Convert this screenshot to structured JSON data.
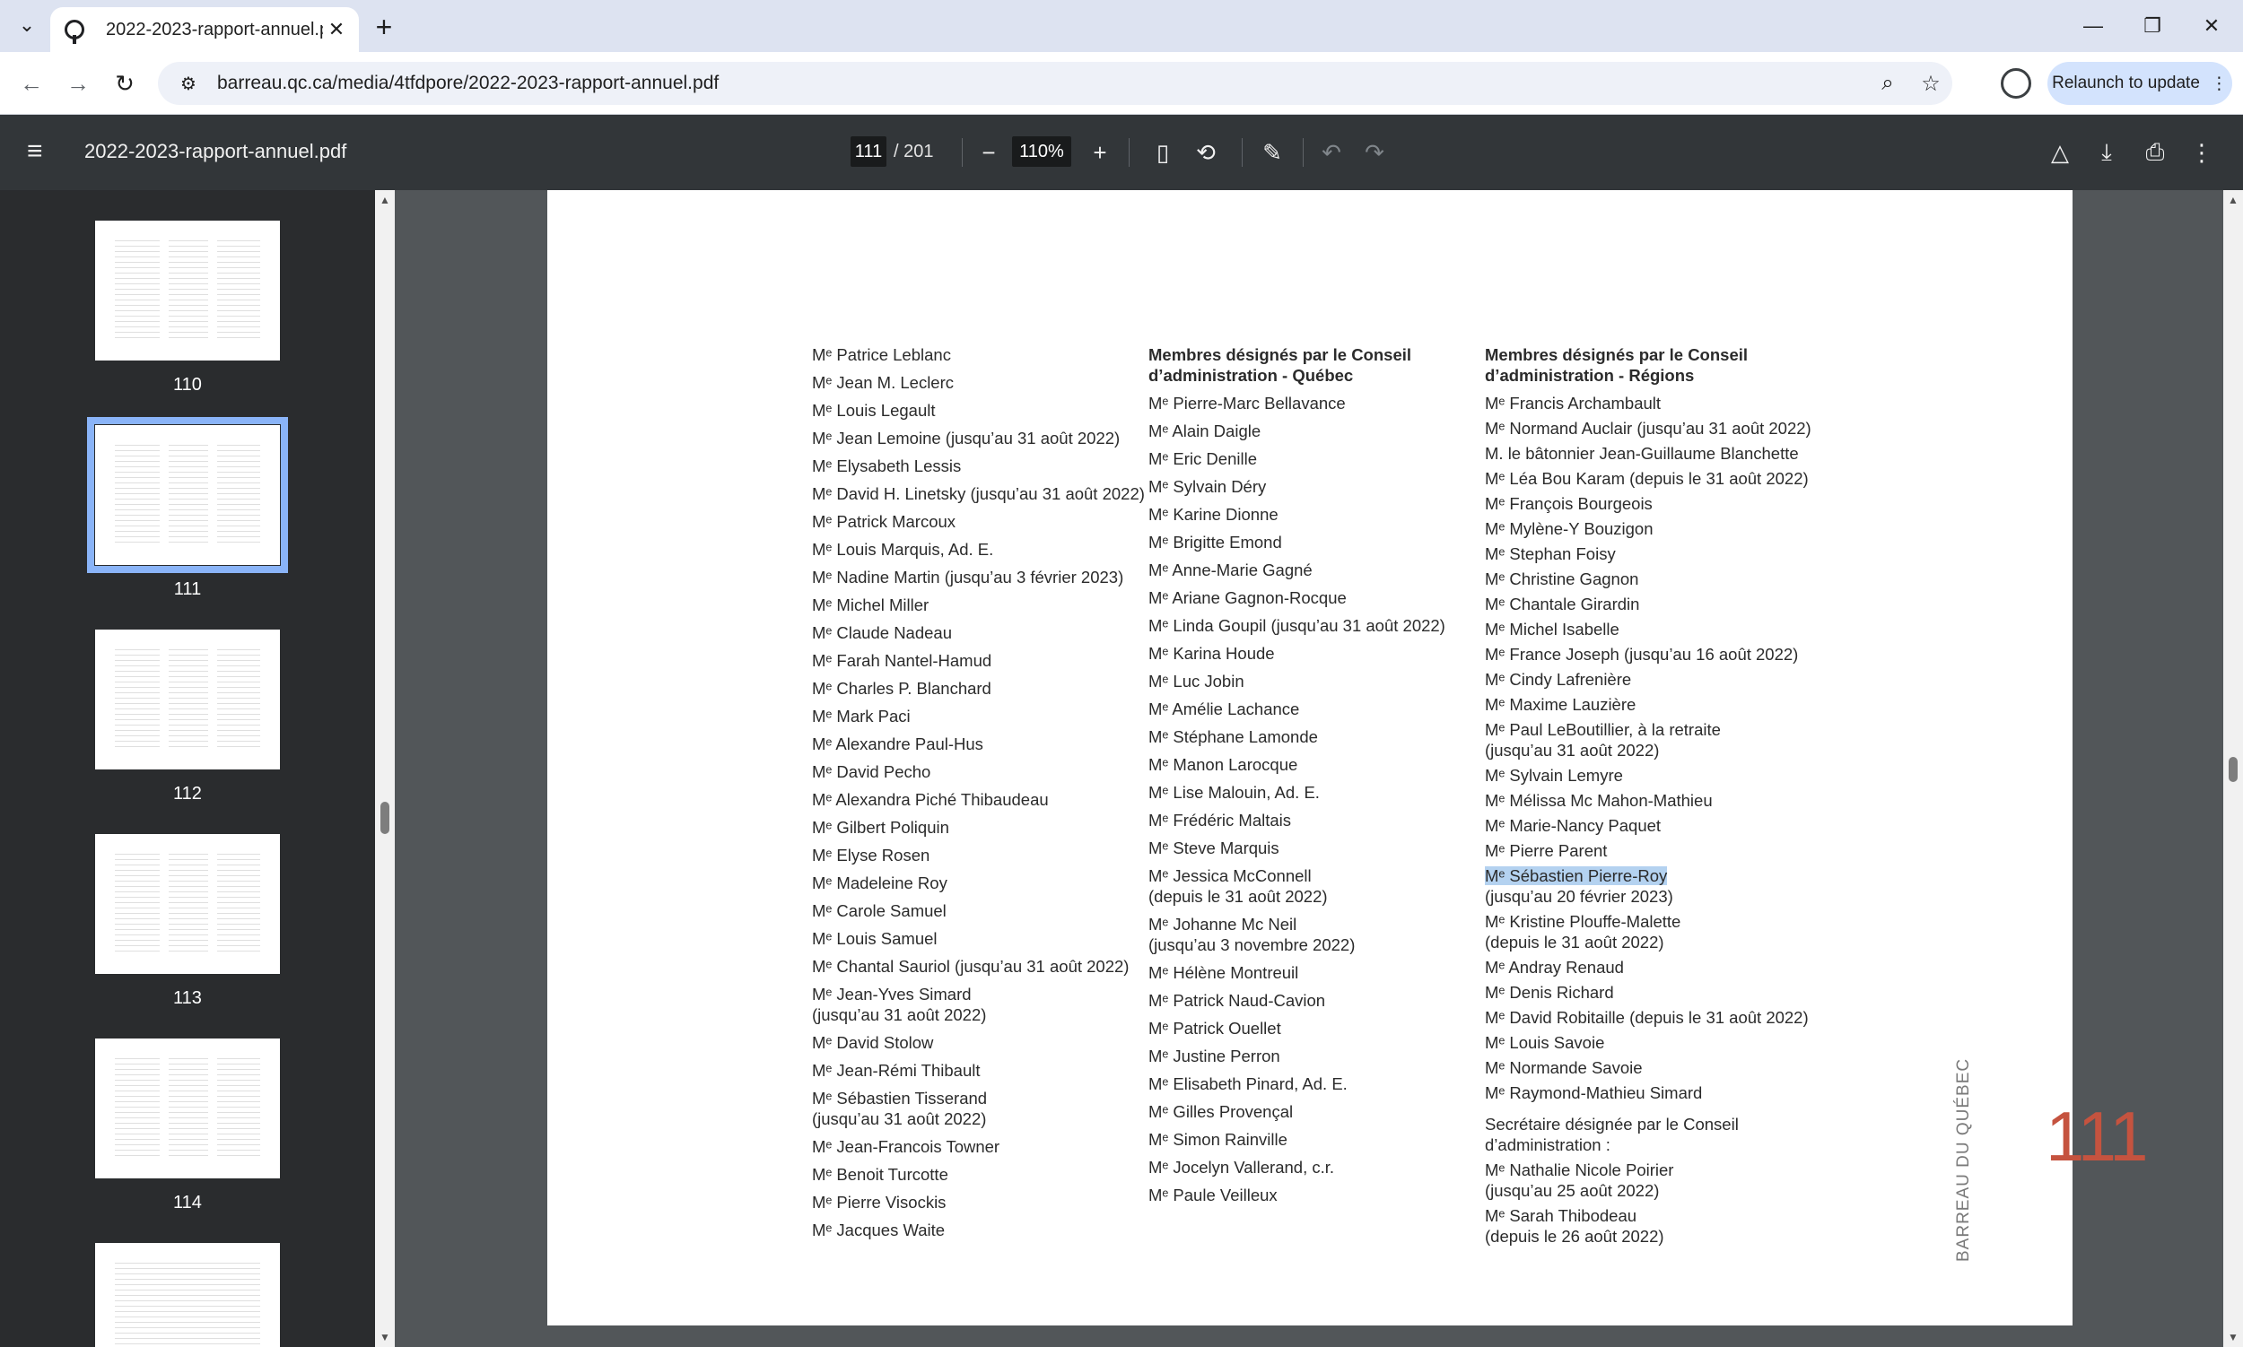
{
  "browser": {
    "tab_title": "2022-2023-rapport-annuel.pdf",
    "url": "barreau.qc.ca/media/4tfdpore/2022-2023-rapport-annuel.pdf",
    "relaunch_label": "Relaunch to update"
  },
  "pdf_toolbar": {
    "title": "2022-2023-rapport-annuel.pdf",
    "current_page": "111",
    "total_pages": "/ 201",
    "zoom": "110%"
  },
  "thumbnails": [
    {
      "label": "110"
    },
    {
      "label": "111"
    },
    {
      "label": "112"
    },
    {
      "label": "113"
    },
    {
      "label": "114"
    }
  ],
  "page": {
    "col1": [
      "Mᵉ Patrice Leblanc",
      "Mᵉ Jean M. Leclerc",
      "Mᵉ Louis Legault",
      "Mᵉ Jean Lemoine (jusqu’au 31 août 2022)",
      "Mᵉ Elysabeth Lessis",
      "Mᵉ David H. Linetsky (jusqu’au 31 août 2022)",
      "Mᵉ Patrick Marcoux",
      "Mᵉ Louis Marquis, Ad. E.",
      "Mᵉ Nadine Martin (jusqu’au 3 février 2023)",
      "Mᵉ Michel Miller",
      "Mᵉ Claude Nadeau",
      "Mᵉ Farah Nantel-Hamud",
      "Mᵉ Charles P. Blanchard",
      "Mᵉ Mark Paci",
      "Mᵉ Alexandre Paul-Hus",
      "Mᵉ David Pecho",
      "Mᵉ Alexandra Piché Thibaudeau",
      "Mᵉ Gilbert Poliquin",
      "Mᵉ Elyse Rosen",
      "Mᵉ Madeleine Roy",
      "Mᵉ Carole Samuel",
      "Mᵉ Louis Samuel",
      "Mᵉ Chantal Sauriol (jusqu’au 31 août 2022)",
      "Mᵉ Jean-Yves Simard\n(jusqu’au 31 août 2022)",
      "Mᵉ David Stolow",
      "Mᵉ Jean-Rémi Thibault",
      "Mᵉ Sébastien Tisserand\n(jusqu’au 31 août 2022)",
      "Mᵉ Jean-Francois Towner",
      "Mᵉ Benoit Turcotte",
      "Mᵉ Pierre Visockis",
      "Mᵉ Jacques Waite"
    ],
    "col2_heading": "Membres désignés par le Conseil\nd’administration - Québec",
    "col2": [
      "Mᵉ Pierre-Marc Bellavance",
      "Mᵉ Alain Daigle",
      "Mᵉ Eric Denille",
      "Mᵉ Sylvain Déry",
      "Mᵉ Karine Dionne",
      "Mᵉ Brigitte Emond",
      "Mᵉ Anne-Marie Gagné",
      "Mᵉ Ariane Gagnon-Rocque",
      "Mᵉ Linda Goupil (jusqu’au 31 août 2022)",
      "Mᵉ Karina Houde",
      "Mᵉ Luc Jobin",
      "Mᵉ Amélie Lachance",
      "Mᵉ Stéphane Lamonde",
      "Mᵉ Manon Larocque",
      "Mᵉ Lise Malouin, Ad. E.",
      "Mᵉ Frédéric Maltais",
      "Mᵉ Steve Marquis",
      "Mᵉ Jessica McConnell\n(depuis le 31 août 2022)",
      "Mᵉ Johanne Mc Neil\n(jusqu’au 3 novembre 2022)",
      "Mᵉ Hélène Montreuil",
      "Mᵉ Patrick Naud-Cavion",
      "Mᵉ Patrick Ouellet",
      "Mᵉ Justine Perron",
      "Mᵉ Elisabeth Pinard, Ad. E.",
      "Mᵉ Gilles Provençal",
      "Mᵉ Simon Rainville",
      "Mᵉ Jocelyn Vallerand, c.r.",
      "Mᵉ Paule Veilleux"
    ],
    "col3_heading": "Membres désignés par le Conseil\nd’administration - Régions",
    "col3_before": [
      "Mᵉ Francis Archambault",
      "Mᵉ Normand Auclair (jusqu’au 31 août 2022)",
      "M. le bâtonnier Jean-Guillaume Blanchette",
      "Mᵉ Léa Bou Karam (depuis le 31 août 2022)",
      "Mᵉ François Bourgeois",
      "Mᵉ Mylène-Y Bouzigon",
      "Mᵉ Stephan Foisy",
      "Mᵉ Christine Gagnon",
      "Mᵉ Chantale Girardin",
      "Mᵉ Michel Isabelle",
      "Mᵉ France Joseph (jusqu’au 16 août 2022)",
      "Mᵉ Cindy Lafrenière",
      "Mᵉ Maxime Lauzière",
      "Mᵉ Paul LeBoutillier, à la retraite\n(jusqu’au 31 août 2022)",
      "Mᵉ Sylvain Lemyre",
      "Mᵉ Mélissa Mc Mahon-Mathieu",
      "Mᵉ Marie-Nancy Paquet",
      "Mᵉ Pierre Parent"
    ],
    "col3_selected_name": "Mᵉ Sébastien Pierre-Roy",
    "col3_selected_note": "(jusqu’au 20 février 2023)",
    "col3_after": [
      "Mᵉ Kristine Plouffe-Malette\n(depuis le 31 août 2022)",
      "Mᵉ Andray Renaud",
      "Mᵉ Denis Richard",
      "Mᵉ David Robitaille (depuis le 31 août 2022)",
      "Mᵉ Louis Savoie",
      "Mᵉ Normande Savoie",
      "Mᵉ Raymond-Mathieu Simard"
    ],
    "secretary_heading": "Secrétaire désignée par le Conseil\nd’administration :",
    "secretaries": [
      "Mᵉ Nathalie Nicole Poirier\n(jusqu’au 25 août 2022)",
      "Mᵉ Sarah Thibodeau\n(depuis le 26 août 2022)"
    ],
    "page_number": "111",
    "vertical_label": "BARREAU DU QUÉBEC"
  }
}
